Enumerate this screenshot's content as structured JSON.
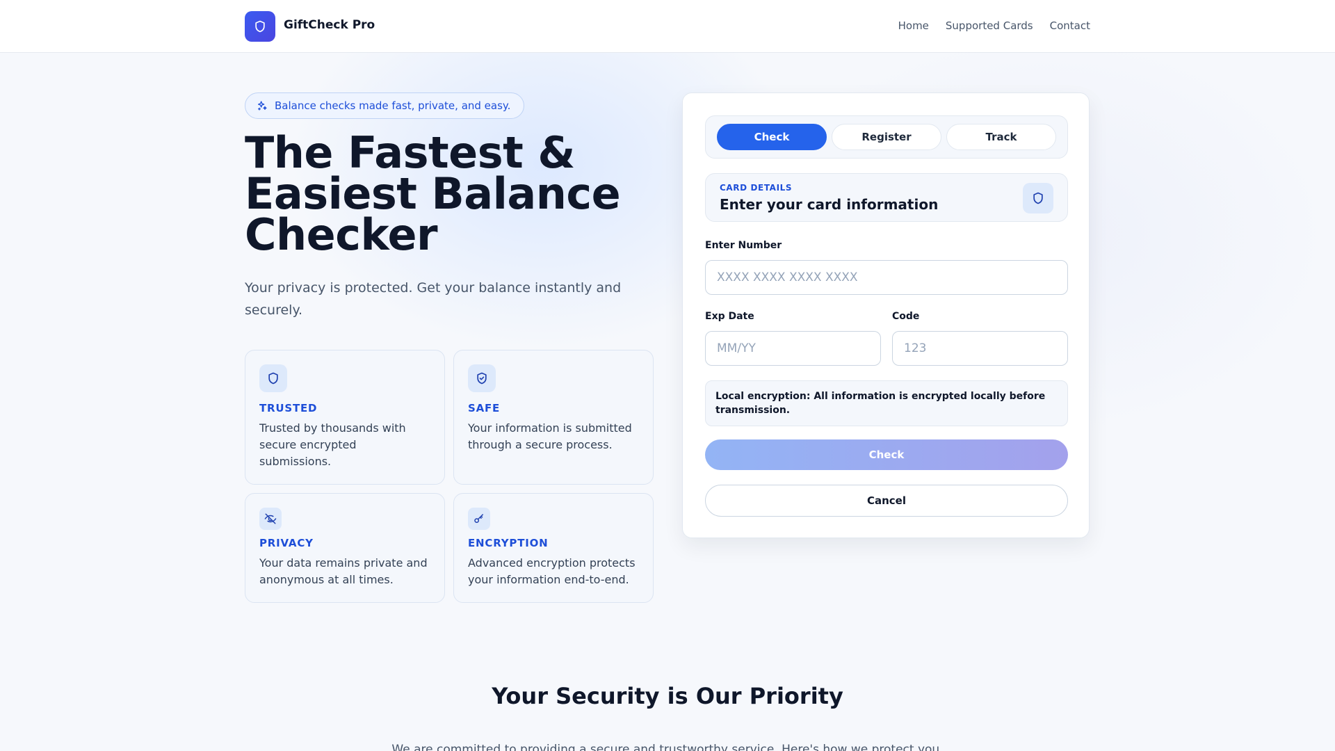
{
  "header": {
    "brand": "GiftCheck Pro",
    "nav": [
      {
        "label": "Home"
      },
      {
        "label": "Supported Cards"
      },
      {
        "label": "Contact"
      }
    ]
  },
  "hero": {
    "pill": "Balance checks made fast, private, and easy.",
    "title": "The Fastest & Easiest Balance Checker",
    "subtitle": "Your privacy is protected. Get your balance instantly and securely."
  },
  "features": [
    {
      "title": "TRUSTED",
      "desc": "Trusted by thousands with secure encrypted submissions.",
      "icon": "shield-icon"
    },
    {
      "title": "SAFE",
      "desc": "Your information is submitted through a secure process.",
      "icon": "shield-check-icon"
    },
    {
      "title": "PRIVACY",
      "desc": "Your data remains private and anonymous at all times.",
      "icon": "eye-off-icon"
    },
    {
      "title": "ENCRYPTION",
      "desc": "Advanced encryption protects your information end-to-end.",
      "icon": "key-icon"
    }
  ],
  "form": {
    "tabs": [
      {
        "label": "Check",
        "active": true
      },
      {
        "label": "Register",
        "active": false
      },
      {
        "label": "Track",
        "active": false
      }
    ],
    "details_label": "CARD DETAILS",
    "details_title": "Enter your card information",
    "number_label": "Enter Number",
    "number_placeholder": "XXXX XXXX XXXX XXXX",
    "exp_label": "Exp Date",
    "exp_placeholder": "MM/YY",
    "code_label": "Code",
    "code_placeholder": "123",
    "notice": "Local encryption: All information is encrypted locally before transmission.",
    "submit_label": "Check",
    "cancel_label": "Cancel"
  },
  "security": {
    "title": "Your Security is Our Priority",
    "subtitle": "We are committed to providing a secure and trustworthy service. Here's how we protect you."
  },
  "colors": {
    "accent": "#2563eb",
    "brand": "#3b5bf0",
    "feature_title": "#1d4ed8"
  }
}
